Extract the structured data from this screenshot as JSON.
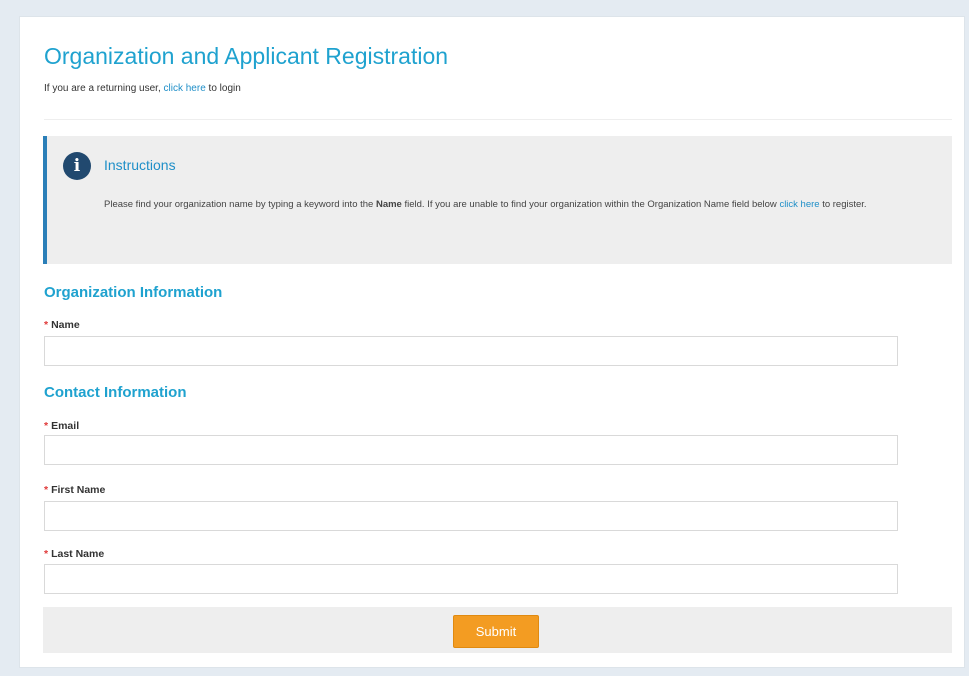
{
  "page": {
    "title": "Organization and Applicant Registration",
    "returning_prefix": "If you are a returning user, ",
    "returning_link": "click here",
    "returning_suffix": " to login"
  },
  "instructions": {
    "icon": "info-icon",
    "title": "Instructions",
    "text_1": "Please find your organization name by typing a keyword into the ",
    "text_bold": "Name",
    "text_2": " field. If you are unable to find your organization within the Organization Name field below ",
    "link": "click here",
    "text_3": " to register."
  },
  "org_section": {
    "heading": "Organization Information",
    "name_label": "Name",
    "name_value": ""
  },
  "contact_section": {
    "heading": "Contact Information",
    "email_label": "Email",
    "email_value": "",
    "first_name_label": "First Name",
    "first_name_value": "",
    "last_name_label": "Last Name",
    "last_name_value": ""
  },
  "required_marker": "*",
  "footer": {
    "submit_label": "Submit"
  },
  "colors": {
    "accent": "#1fa2cf",
    "link": "#1f8fc8",
    "submit": "#f39c22",
    "required": "#e03a3a",
    "info_icon": "#21496f"
  }
}
